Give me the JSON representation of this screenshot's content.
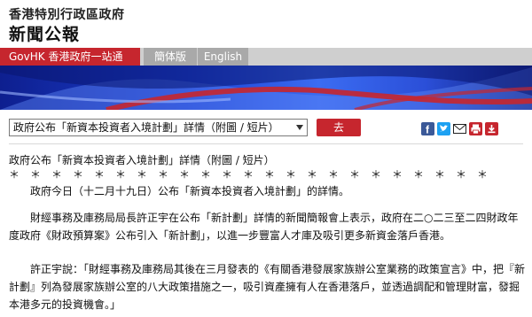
{
  "masthead": {
    "gov_name": "香港特別行政區政府",
    "press_title": "新聞公報"
  },
  "nav": {
    "govhk_label": "GovHK 香港政府一站通",
    "simplified_label": "簡体版",
    "english_label": "English"
  },
  "controls": {
    "selected_title": "政府公布「新資本投資者入境計劃」詳情（附圖 / 短片）",
    "go_label": "去"
  },
  "share_icons": [
    "facebook-icon",
    "twitter-icon",
    "email-icon",
    "print-icon",
    "save-icon"
  ],
  "colors": {
    "accent_red": "#c6262e",
    "banner_blue": "#1b3fd1",
    "nav_grey": "#a9a9a9"
  },
  "article": {
    "headline": "政府公布「新資本投資者入境計劃」詳情（附圖 / 短片）",
    "stars": "＊　＊　＊　＊　＊　＊　＊　＊　＊　＊　＊　＊　＊　＊　＊　＊　＊　＊　＊　＊　＊　＊　＊",
    "paragraphs": [
      "　　政府今日（十二月十九日）公布「新資本投資者入境計劃」的詳情。",
      "　　財經事務及庫務局局長許正宇在公布「新計劃」詳情的新聞簡報會上表示，政府在二○二三至二四財政年度政府《財政預算案》公布引入「新計劃」，以進一步豐富人才庫及吸引更多新資金落戶香港。",
      "　　許正宇說：「財經事務及庫務局其後在三月發表的《有關香港發展家族辦公室業務的政策宣言》中，把『新計劃』列為發展家族辦公室的八大政策措施之一，吸引資產擁有人在香港落戶，並透過調配和管理財富，發掘本港多元的投資機會。」"
    ]
  }
}
